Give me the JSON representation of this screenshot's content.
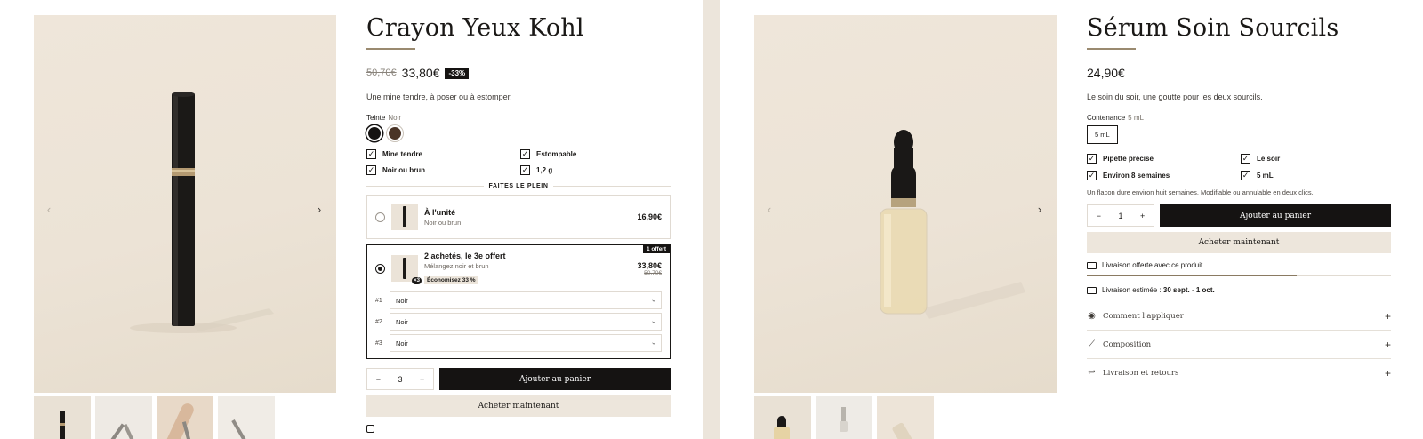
{
  "kohl": {
    "title": "Crayon Yeux Kohl",
    "old_price": "50,70€",
    "price": "33,80€",
    "discount_badge": "-33%",
    "tagline": "Une mine tendre, à poser ou à estomper.",
    "shade_label": "Teinte",
    "shade_value": "Noir",
    "swatches": [
      {
        "name": "Noir",
        "color": "#151312"
      },
      {
        "name": "Brun",
        "color": "#4a3426"
      }
    ],
    "features": [
      "Mine tendre",
      "Estompable",
      "Noir ou brun",
      "1,2 g"
    ],
    "bundle_heading": "FAITES LE PLEIN",
    "offers": [
      {
        "name": "À l'unité",
        "sub": "Noir ou brun",
        "price": "16,90€"
      },
      {
        "name": "2 achetés, le 3e offert",
        "sub": "Mélangez noir et brun",
        "saving": "Économisez 33 %",
        "price": "33,80€",
        "old_price": "50,70€",
        "corner_tag": "1 offert",
        "thumb_badge": "×3"
      }
    ],
    "selects": [
      {
        "num": "#1",
        "value": "Noir"
      },
      {
        "num": "#2",
        "value": "Noir"
      },
      {
        "num": "#3",
        "value": "Noir"
      }
    ],
    "qty": "3",
    "qty_minus": "−",
    "qty_plus": "+",
    "add_to_cart": "Ajouter au panier",
    "buy_now": "Acheter maintenant",
    "next_arrow": "›",
    "prev_arrow": "‹"
  },
  "serum": {
    "title": "Sérum Soin Sourcils",
    "price": "24,90€",
    "tagline": "Le soin du soir, une goutte pour les deux sourcils.",
    "size_label": "Contenance",
    "size_value": "5 mL",
    "size_option": "5 mL",
    "features": [
      "Pipette précise",
      "Le soir",
      "Environ 8 semaines",
      "5 mL"
    ],
    "note": "Un flacon dure environ huit semaines. Modifiable ou annulable en deux clics.",
    "qty": "1",
    "qty_minus": "−",
    "qty_plus": "+",
    "add_to_cart": "Ajouter au panier",
    "buy_now": "Acheter maintenant",
    "free_shipping": "Livraison offerte avec ce produit",
    "free_shipping_progress": 0.69,
    "delivery_prefix": "Livraison estimée : ",
    "delivery_dates": "30 sept. - 1 oct.",
    "accordion": [
      "Comment l'appliquer",
      "Composition",
      "Livraison et retours"
    ],
    "next_arrow": "›",
    "prev_arrow": "‹"
  }
}
